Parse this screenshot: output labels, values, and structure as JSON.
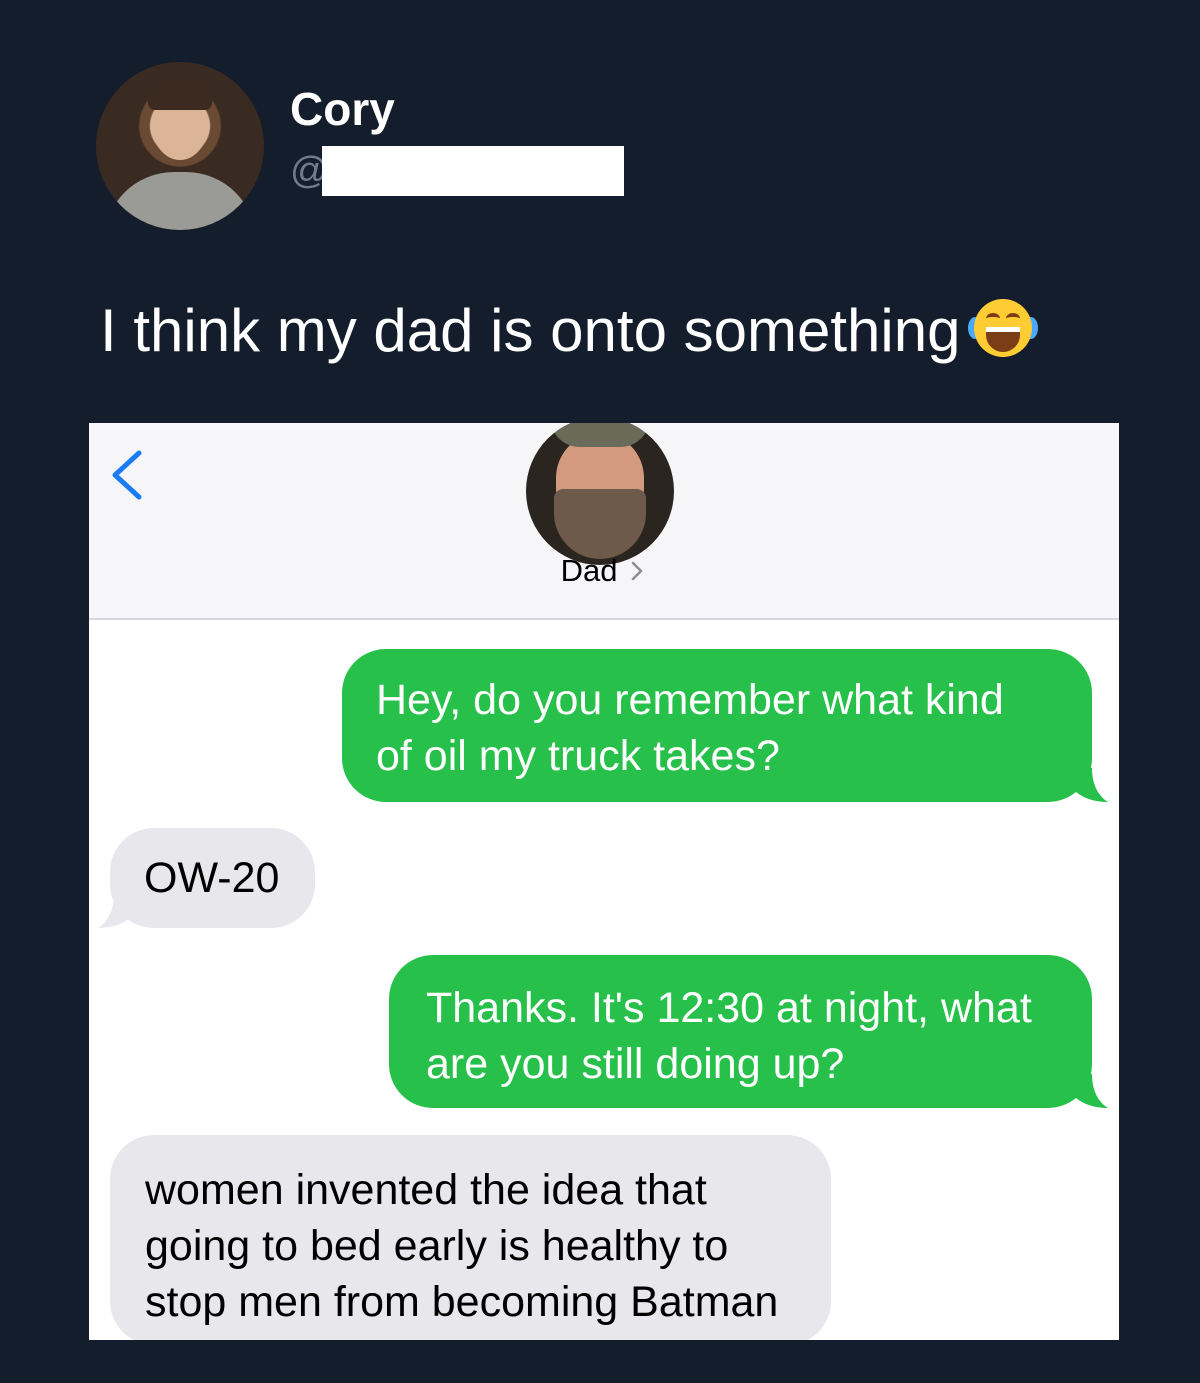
{
  "tweet": {
    "author_name": "Cory",
    "handle_prefix": "@",
    "text": "I think my dad is onto something",
    "emoji": "face-with-tears-of-joy"
  },
  "messages_screen": {
    "contact_name": "Dad",
    "messages": [
      {
        "direction": "outgoing",
        "lines": [
          "Hey, do you remember what kind",
          "of oil my truck takes?"
        ]
      },
      {
        "direction": "incoming",
        "lines": [
          "OW-20"
        ]
      },
      {
        "direction": "outgoing",
        "lines": [
          "Thanks. It's 12:30 at night, what",
          "are you still doing up?"
        ]
      },
      {
        "direction": "incoming",
        "lines": [
          "women invented the idea that",
          "going to bed early is healthy to",
          "stop men from becoming Batman"
        ]
      }
    ]
  },
  "colors": {
    "background": "#141d2b",
    "outgoing_bubble": "#27c04a",
    "incoming_bubble": "#e7e7ec",
    "ios_blue": "#1a7cf5"
  }
}
